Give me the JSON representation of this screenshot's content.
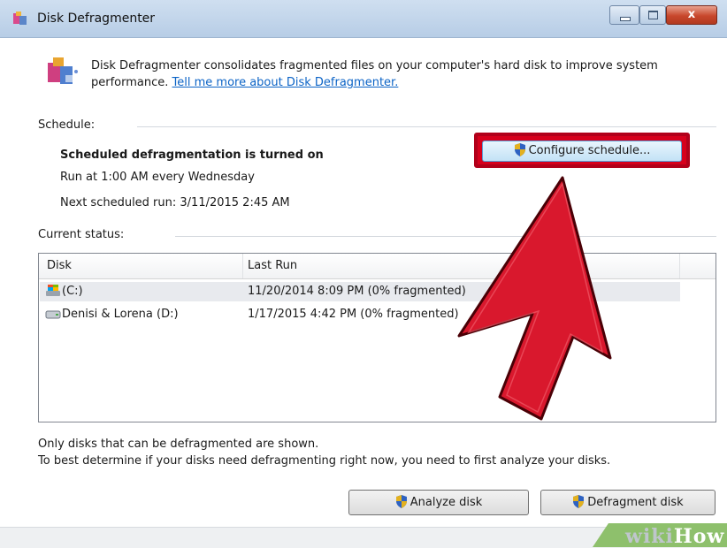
{
  "window": {
    "title": "Disk Defragmenter",
    "close_glyph": "x"
  },
  "intro": {
    "text": "Disk Defragmenter consolidates fragmented files on your computer's hard disk to improve system performance.",
    "link": "Tell me more about Disk Defragmenter."
  },
  "schedule": {
    "section_label": "Schedule:",
    "status": "Scheduled defragmentation is turned on",
    "run_at": "Run at 1:00 AM every Wednesday",
    "next_run": "Next scheduled run: 3/11/2015 2:45 AM",
    "configure_button": "Configure schedule..."
  },
  "current_status": {
    "section_label": "Current status:",
    "columns": {
      "disk": "Disk",
      "last_run": "Last Run"
    },
    "rows": [
      {
        "disk": "(C:)",
        "last_run": "11/20/2014 8:09 PM (0% fragmented)",
        "icon": "system-drive-icon",
        "selected": true
      },
      {
        "disk": "Denisi & Lorena (D:)",
        "last_run": "1/17/2015 4:42 PM (0% fragmented)",
        "icon": "hard-drive-icon",
        "selected": false
      }
    ]
  },
  "notes": {
    "line1": "Only disks that can be defragmented are shown.",
    "line2": "To best determine if your disks need defragmenting right now, you need to first analyze your disks."
  },
  "buttons": {
    "analyze": "Analyze disk",
    "defragment": "Defragment disk"
  },
  "watermark": {
    "part1": "wiki",
    "part2": "How"
  },
  "colors": {
    "highlight": "#d6001c",
    "arrow": "#d9182d",
    "link": "#0b63c6"
  }
}
